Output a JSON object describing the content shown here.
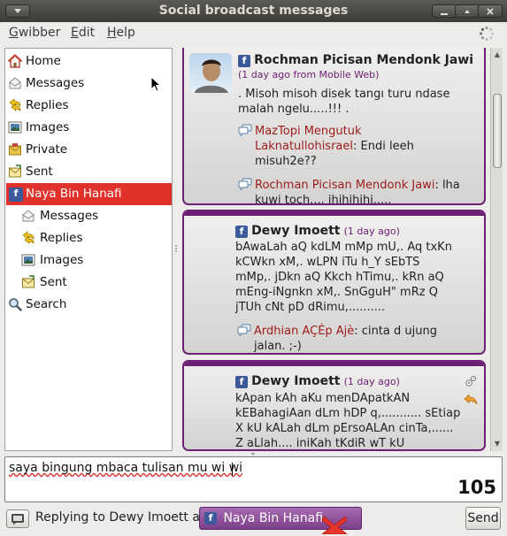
{
  "window": {
    "title": "Social broadcast messages"
  },
  "menu": {
    "items": [
      "Gwibber",
      "Edit",
      "Help"
    ]
  },
  "sidebar": {
    "items": [
      {
        "label": "Home",
        "icon": "home-icon"
      },
      {
        "label": "Messages",
        "icon": "messages-icon"
      },
      {
        "label": "Replies",
        "icon": "replies-icon"
      },
      {
        "label": "Images",
        "icon": "images-icon"
      },
      {
        "label": "Private",
        "icon": "private-icon"
      },
      {
        "label": "Sent",
        "icon": "sent-icon"
      },
      {
        "label": "Naya Bin Hanafi",
        "icon": "facebook-icon",
        "selected": true
      },
      {
        "label": "Messages",
        "icon": "messages-icon",
        "sub": true
      },
      {
        "label": "Replies",
        "icon": "replies-icon",
        "sub": true
      },
      {
        "label": "Images",
        "icon": "images-icon",
        "sub": true
      },
      {
        "label": "Sent",
        "icon": "sent-icon",
        "sub": true
      },
      {
        "label": "Search",
        "icon": "search-icon"
      }
    ]
  },
  "feed": {
    "posts": [
      {
        "author": "Rochman Picisan Mendonk Jawi",
        "meta": "(1 day ago from Mobile Web)",
        "text": ". Misoh misoh disek tangı turu ndase malah ngelu.....!!! .",
        "comments": [
          {
            "name": "MazTopi Mengutuk Laknatullohisrael",
            "text": ": Endi leeh misuh2e??"
          },
          {
            "name": "Rochman Picisan Mendonk Jawi",
            "text": ": lha kuwi toch.... ihihihihi....."
          }
        ]
      },
      {
        "author": "Dewy Imoett",
        "meta": "(1 day ago)",
        "text": "bAwaLah aQ kdLM mMp mU,. Aq txKn kCWkn xM,. wLPN iTu h_Y sEbTS mMp,. jDkn aQ Kkch hTimu,. kRn aQ mEng-iNgnkn xM,. SnGguH\" mRz Q jTUh cNt pD dRimu,..........",
        "comments": [
          {
            "name": "Ardhian AÇÉp Ajè",
            "text": ": cinta d ujung jalan. ;-)"
          }
        ]
      },
      {
        "author": "Dewy Imoett",
        "meta": "(1 day ago)",
        "text": "kApan kAh aKu menDApatkAN kEBahagiAan dLm hDP q,........... sEtiap X kU kALah dLm pErsoALAn cinTa,...... Z aLlah.... iniKah tKdiR wT kU",
        "comments": []
      }
    ]
  },
  "compose": {
    "text": "saya bingung mbaca tulisan mu wi wi",
    "remaining": "105"
  },
  "status": {
    "replying": "Replying to Dewy Imoett as",
    "account": "Naya Bin Hanafi",
    "send_label": "Send"
  },
  "colors": {
    "accent": "#6b2074",
    "selected": "#e0312a",
    "reply_name": "#9c1b1b",
    "facebook": "#3b5998"
  }
}
